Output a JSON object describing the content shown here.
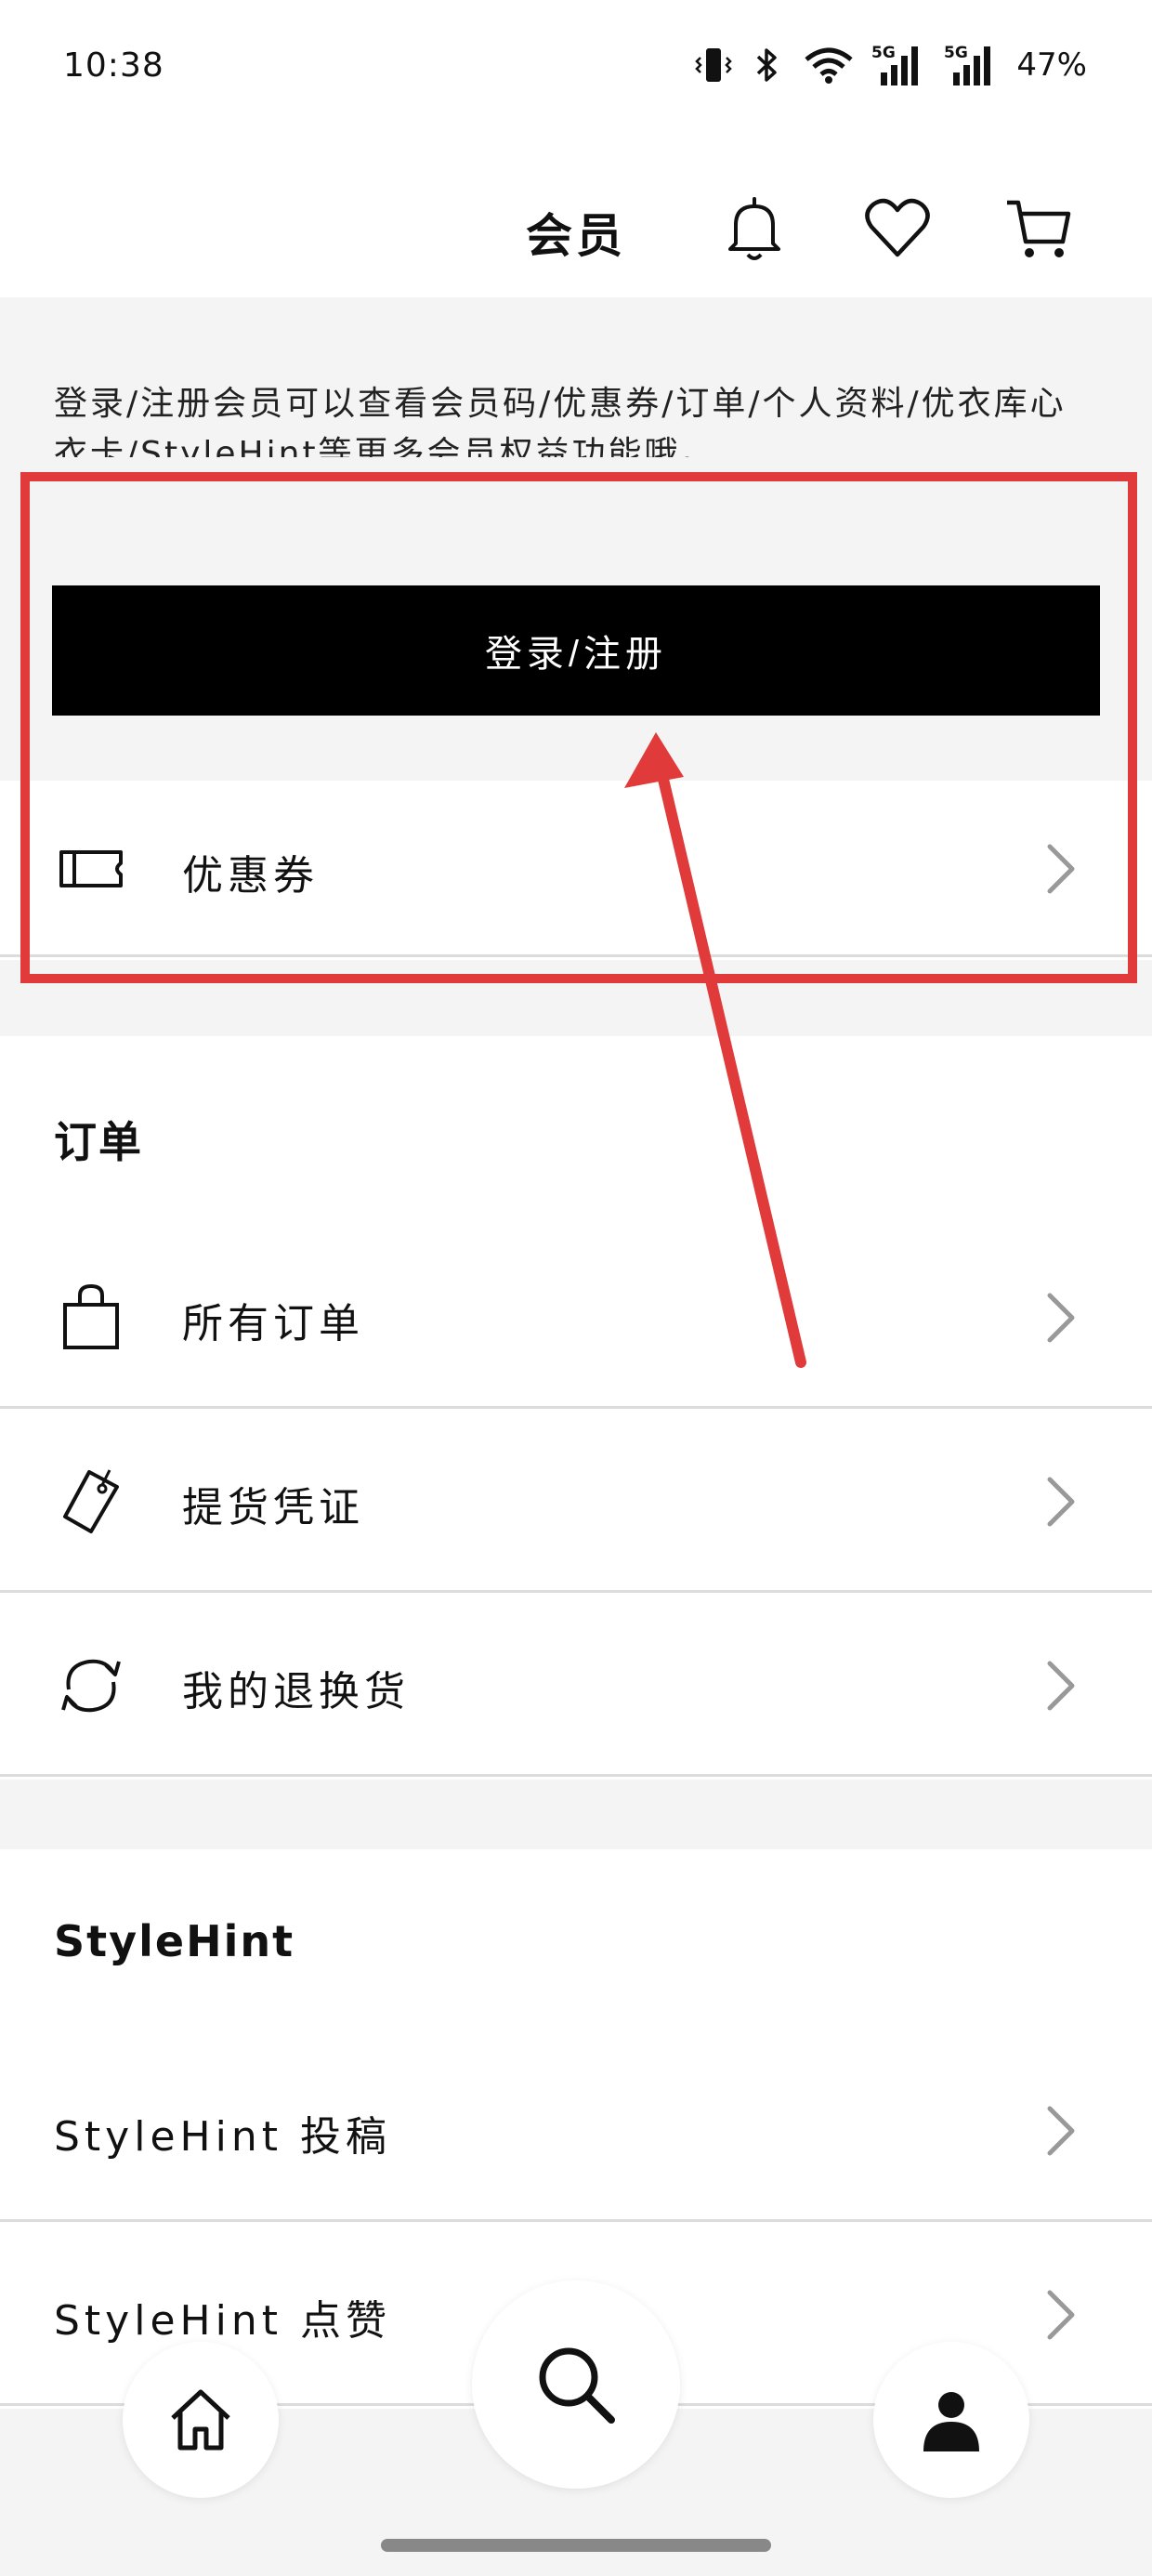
{
  "status_bar": {
    "time": "10:38",
    "battery": "47%",
    "network_1": "5G",
    "network_2": "5G"
  },
  "header": {
    "title": "会员",
    "icons": [
      "bell-icon",
      "heart-icon",
      "cart-icon"
    ]
  },
  "login": {
    "description": "登录/注册会员可以查看会员码/优惠券/订单/个人资料/优衣库心衣卡/StyleHint等更多会员权益功能哦。",
    "button_label": "登录/注册"
  },
  "coupon": {
    "label": "优惠券",
    "icon": "ticket-icon"
  },
  "orders": {
    "title": "订单",
    "items": [
      {
        "label": "所有订单",
        "icon": "shopping-bag-icon"
      },
      {
        "label": "提货凭证",
        "icon": "tag-icon"
      },
      {
        "label": "我的退换货",
        "icon": "refresh-icon"
      }
    ]
  },
  "stylehint": {
    "title": "StyleHint",
    "items": [
      {
        "label": "StyleHint 投稿"
      },
      {
        "label": "StyleHint 点赞"
      }
    ]
  },
  "bottom_nav": {
    "items": [
      "home-icon",
      "search-icon",
      "account-icon"
    ]
  },
  "colors": {
    "annotation_red": "#e03a3a",
    "button_black": "#000000",
    "section_gray": "#f4f4f4"
  }
}
